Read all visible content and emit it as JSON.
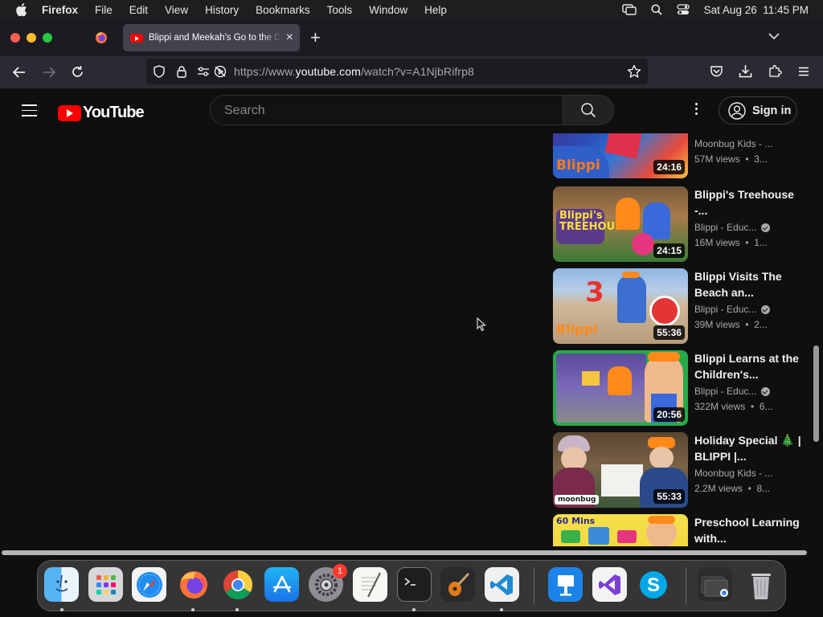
{
  "menubar": {
    "app_name": "Firefox",
    "items": [
      "File",
      "Edit",
      "View",
      "History",
      "Bookmarks",
      "Tools",
      "Window",
      "Help"
    ],
    "clock": "Sat Aug 26  11:45 PM"
  },
  "browser": {
    "active_tab_title": "Blippi and Meekah's Go to the Dentist",
    "url_prefix": "https://www.",
    "url_host": "youtube.com",
    "url_path": "/watch?v=A1NjbRifrp8"
  },
  "youtube": {
    "logo_text": "YouTube",
    "search_placeholder": "Search",
    "sign_in_label": "Sign in"
  },
  "videos": [
    {
      "title": "",
      "channel": "Moonbug Kids - ...",
      "verified": false,
      "stats": "57M views  •  3...",
      "duration": "24:16"
    },
    {
      "title": "Blippi's Treehouse -...",
      "channel": "Blippi - Educ...",
      "verified": true,
      "stats": "16M views  •  1...",
      "duration": "24:15"
    },
    {
      "title": "Blippi Visits The Beach an...",
      "channel": "Blippi - Educ...",
      "verified": true,
      "stats": "39M views  •  2...",
      "duration": "55:36"
    },
    {
      "title": "Blippi Learns at the Children's...",
      "channel": "Blippi - Educ...",
      "verified": true,
      "stats": "322M views  •  6...",
      "duration": "20:56"
    },
    {
      "title": "Holiday Special 🎄 | BLIPPI |...",
      "channel": "Moonbug Kids - ...",
      "verified": false,
      "stats": "2.2M views  •  8...",
      "duration": "55:33"
    },
    {
      "title": "Preschool Learning with...",
      "channel": "",
      "verified": false,
      "stats": "",
      "duration": ""
    }
  ],
  "dock": {
    "settings_badge": "1"
  }
}
